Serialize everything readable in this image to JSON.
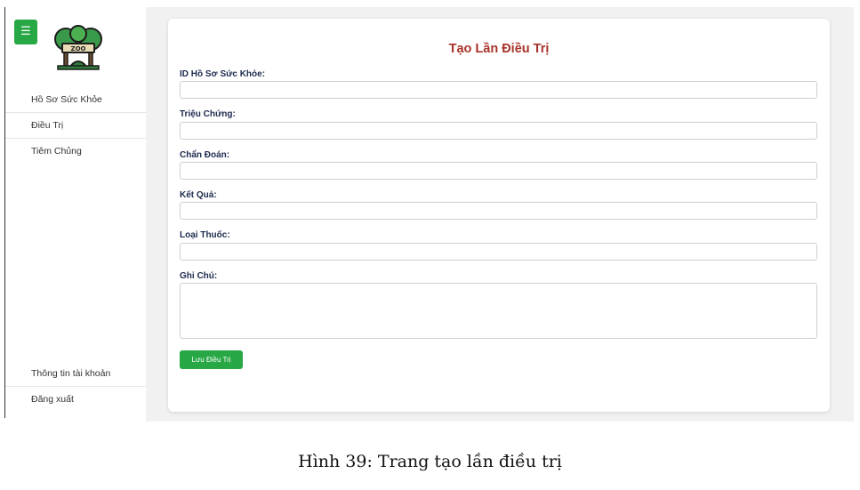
{
  "sidebar": {
    "menu_icon": "☰",
    "logo_text": "ZOO",
    "logo_icon": "zoo-logo-icon",
    "nav_items": [
      {
        "label": "Hồ Sơ Sức Khỏe"
      },
      {
        "label": "Điều Trị"
      },
      {
        "label": "Tiêm Chủng"
      }
    ],
    "account_label": "Thông tin tài khoản",
    "logout_label": "Đăng xuất"
  },
  "form": {
    "title": "Tạo Lần Điều Trị",
    "fields": [
      {
        "label": "ID Hồ Sơ Sức Khỏe:",
        "value": ""
      },
      {
        "label": "Triệu Chứng:",
        "value": ""
      },
      {
        "label": "Chẩn Đoán:",
        "value": ""
      },
      {
        "label": "Kết Quả:",
        "value": ""
      },
      {
        "label": "Loại Thuốc:",
        "value": ""
      }
    ],
    "note": {
      "label": "Ghi Chú:",
      "value": ""
    },
    "submit_label": "Lưu Điều Trị"
  },
  "caption": "Hình 39: Trang tạo lần điều trị",
  "colors": {
    "accent_green": "#28a745",
    "title_red": "#a8332a",
    "label_navy": "#1d2a4d",
    "content_bg": "#f1f1f1"
  }
}
